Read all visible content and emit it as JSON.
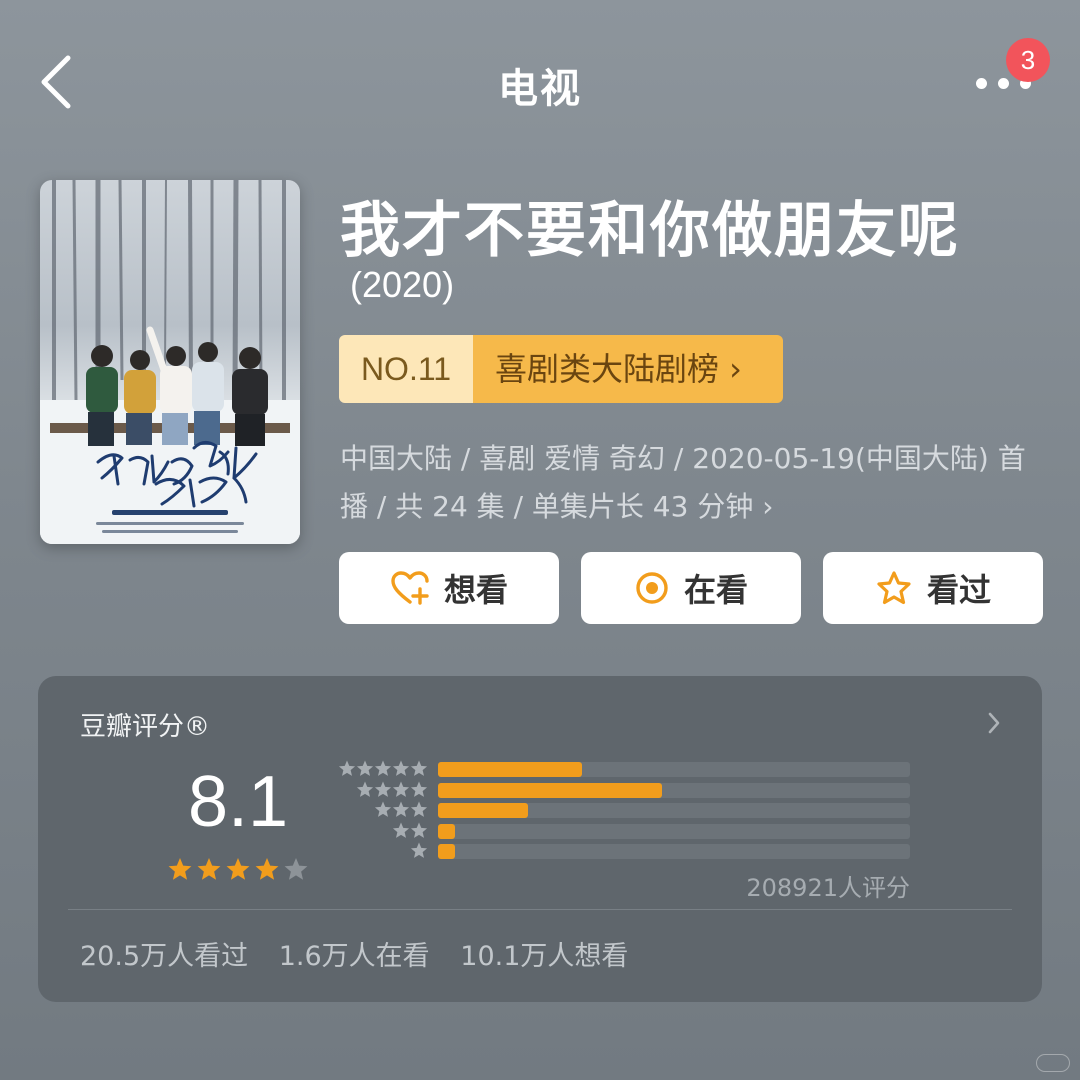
{
  "header": {
    "title": "电视",
    "notification_count": "3"
  },
  "show": {
    "title": "我才不要和你做朋友呢",
    "year": "(2020)",
    "rank_no": "NO.11",
    "rank_list": "喜剧类大陆剧榜 ›",
    "meta_line": "中国大陆 / 喜剧 爱情 奇幻 / 2020-05-19(中国大陆) 首播 / 共 24 集 / 单集片长 43 分钟",
    "meta_chevron": "›",
    "poster": {
      "handwritten_title": "我才不要和你做朋友呢",
      "air_info": "5月19日起 芒果TV全网独播"
    }
  },
  "actions": [
    {
      "label": "想看",
      "icon": "heart-plus-icon"
    },
    {
      "label": "在看",
      "icon": "record-circle-icon"
    },
    {
      "label": "看过",
      "icon": "star-outline-icon"
    }
  ],
  "rating": {
    "title": "豆瓣评分®",
    "score": "8.1",
    "stars": 4,
    "count_text": "208921人评分",
    "distribution": [
      {
        "stars": 5,
        "fraction": 0.305
      },
      {
        "stars": 4,
        "fraction": 0.475
      },
      {
        "stars": 3,
        "fraction": 0.19
      },
      {
        "stars": 2,
        "fraction": 0.035
      },
      {
        "stars": 1,
        "fraction": 0.035
      }
    ],
    "stats": {
      "watched": "20.5万人看过",
      "watching": "1.6万人在看",
      "wish": "10.1万人想看"
    }
  },
  "colors": {
    "accent": "#f29d1c",
    "rank_light": "#fde7b8",
    "rank_dark": "#f6b94a",
    "badge": "#f2545b",
    "card": "#5f666c"
  }
}
